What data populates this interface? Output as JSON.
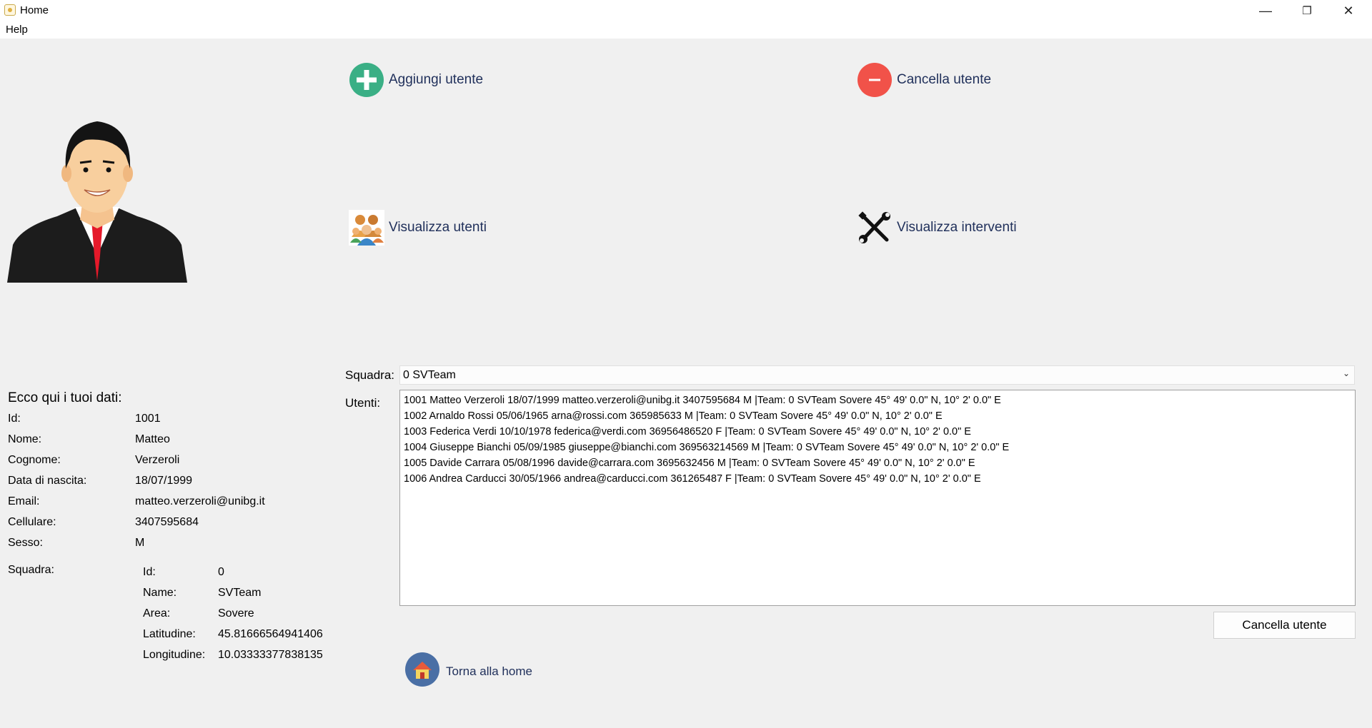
{
  "window": {
    "title": "Home",
    "minimize_glyph": "—",
    "restore_glyph": "❐",
    "close_glyph": "✕"
  },
  "menu": {
    "help": "Help"
  },
  "actions": {
    "add_user": "Aggiungi utente",
    "delete_user": "Cancella utente",
    "view_users": "Visualizza utenti",
    "view_interventions": "Visualizza interventi"
  },
  "profile": {
    "title": "Ecco qui i tuoi dati:",
    "fields": [
      {
        "label": "Id:",
        "value": "1001"
      },
      {
        "label": "Nome:",
        "value": "Matteo"
      },
      {
        "label": "Cognome:",
        "value": "Verzeroli"
      },
      {
        "label": "Data di nascita:",
        "value": "18/07/1999"
      },
      {
        "label": "Email:",
        "value": "matteo.verzeroli@unibg.it"
      },
      {
        "label": "Cellulare:",
        "value": "3407595684"
      },
      {
        "label": "Sesso:",
        "value": "M"
      }
    ],
    "team_label": "Squadra:",
    "team": [
      {
        "label": "Id:",
        "value": "0"
      },
      {
        "label": "Name:",
        "value": "SVTeam"
      },
      {
        "label": "Area:",
        "value": "Sovere"
      },
      {
        "label": "Latitudine:",
        "value": "45.81666564941406"
      },
      {
        "label": "Longitudine:",
        "value": "10.03333377838135"
      }
    ]
  },
  "panel": {
    "squadra_label": "Squadra:",
    "squadra_selected": "0 SVTeam",
    "utenti_label": "Utenti:",
    "users": [
      "1001 Matteo Verzeroli 18/07/1999 matteo.verzeroli@unibg.it 3407595684 M |Team: 0 SVTeam Sovere 45° 49' 0.0\" N, 10° 2' 0.0\" E",
      "1002 Arnaldo Rossi 05/06/1965 arna@rossi.com 365985633 M |Team: 0 SVTeam Sovere 45° 49' 0.0\" N, 10° 2' 0.0\" E",
      "1003 Federica Verdi 10/10/1978 federica@verdi.com 36956486520 F |Team: 0 SVTeam Sovere 45° 49' 0.0\" N, 10° 2' 0.0\" E",
      "1004 Giuseppe Bianchi 05/09/1985 giuseppe@bianchi.com 369563214569 M |Team: 0 SVTeam Sovere 45° 49' 0.0\" N, 10° 2' 0.0\" E",
      "1005 Davide Carrara 05/08/1996 davide@carrara.com 3695632456 M |Team: 0 SVTeam Sovere 45° 49' 0.0\" N, 10° 2' 0.0\" E",
      "1006 Andrea Carducci 30/05/1966 andrea@carducci.com 361265487 F |Team: 0 SVTeam Sovere 45° 49' 0.0\" N, 10° 2' 0.0\" E"
    ],
    "delete_button": "Cancella utente",
    "home_link": "Torna alla home"
  },
  "colors": {
    "add_green": "#3aaf85",
    "delete_red": "#f15249",
    "link_navy": "#1f2f5a",
    "home_blue": "#4a6fa5"
  }
}
